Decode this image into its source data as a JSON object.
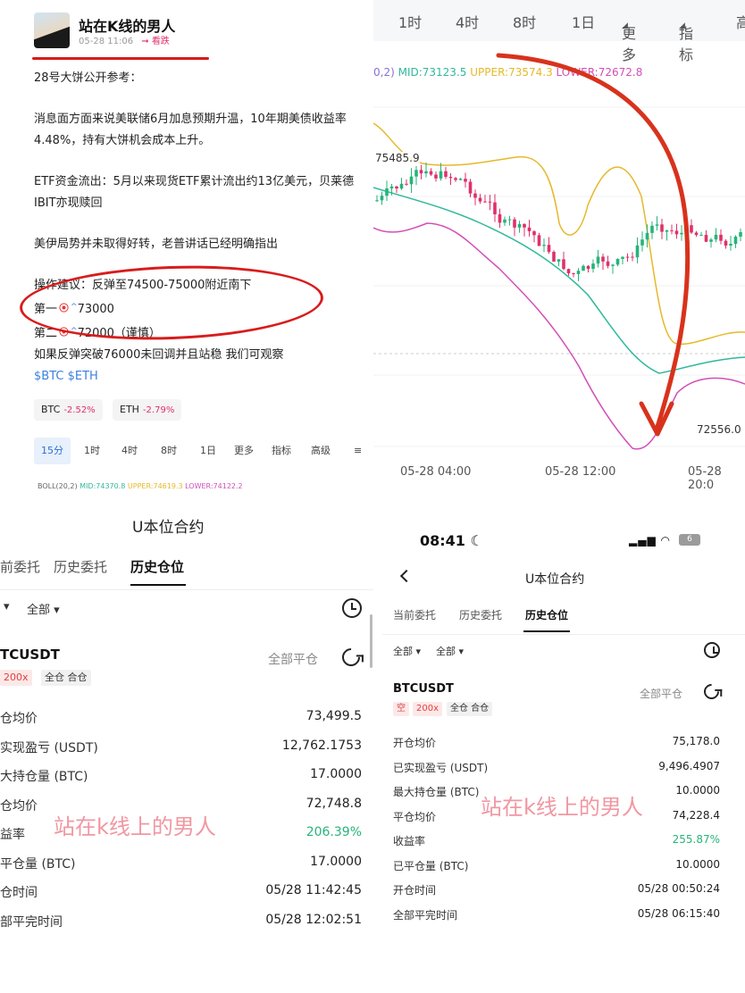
{
  "post": {
    "author": "站在K线的男人",
    "time": "05-28 11:06",
    "tag": "看跌",
    "lines": [
      "28号大饼公开参考：",
      "消息面方面来说美联储6月加息预期升温，10年期美债收益率4.48%，持有大饼机会成本上升。",
      "ETF资金流出：5月以来现货ETF累计流出约13亿美元，贝莱德IBIT亦现赎回",
      "美伊局势并未取得好转，老普讲话已经明确指出",
      "操作建议：反弹至74500-75000附近南下",
      "第一",
      "73000",
      "第二",
      "72000（谨慎）",
      "如果反弹突破76000未回调并且站稳 我们可观察"
    ],
    "hashtags": "$BTC $ETH",
    "coins": [
      {
        "name": "BTC",
        "change": "-2.52%"
      },
      {
        "name": "ETH",
        "change": "-2.79%"
      }
    ],
    "timeframes": [
      "15分",
      "1时",
      "4时",
      "8时",
      "1日",
      "更多",
      "指标",
      "高级"
    ],
    "boll": {
      "prefix": "BOLL(20,2)",
      "mid": "MID:74370.8",
      "upper": "UPPER:74619.3",
      "lower": "LOWER:74122.2"
    }
  },
  "chart": {
    "tabs": [
      "1时",
      "4时",
      "8时",
      "1日",
      "更多",
      "指标",
      "高"
    ],
    "boll": {
      "prefix": "0,2)",
      "mid": "MID:73123.5",
      "upper": "UPPER:73574.3",
      "lower": "LOWER:72672.8"
    },
    "high_label": "75485.9",
    "low_label": "72556.0",
    "time_labels": [
      "05-28 04:00",
      "05-28 12:00",
      "05-28 20:0"
    ],
    "colors": {
      "up": "#26b47a",
      "down": "#e0306b",
      "upper": "#e5b92a",
      "mid": "#2fb99a",
      "lower": "#d24fb8",
      "arrow": "#d8321c"
    }
  },
  "left_history": {
    "title": "U本位合约",
    "tabs": [
      "前委托",
      "历史委托",
      "历史仓位"
    ],
    "filters": [
      "全部"
    ],
    "symbol": "TCUSDT",
    "close_all": "全部平仓",
    "leverage": "200x",
    "mode": "全仓 合仓",
    "rows": [
      {
        "label": "仓均价",
        "value": "73,499.5"
      },
      {
        "label": "实现盈亏 (USDT)",
        "value": "12,762.1753"
      },
      {
        "label": "大持仓量 (BTC)",
        "value": "17.0000"
      },
      {
        "label": "仓均价",
        "value": "72,748.8"
      },
      {
        "label": "益率",
        "value": "206.39%"
      },
      {
        "label": "平仓量 (BTC)",
        "value": "17.0000"
      },
      {
        "label": "仓时间",
        "value": "05/28 11:42:45"
      },
      {
        "label": "部平完时间",
        "value": "05/28 12:02:51"
      }
    ],
    "watermark": "站在k线上的男人"
  },
  "right_history": {
    "status_time": "08:41",
    "battery": "6",
    "title": "U本位合约",
    "tabs": [
      "当前委托",
      "历史委托",
      "历史仓位"
    ],
    "filters": [
      "全部",
      "全部"
    ],
    "symbol": "BTCUSDT",
    "close_all": "全部平仓",
    "side": "空",
    "leverage": "200x",
    "mode": "全仓 合仓",
    "rows": [
      {
        "label": "开仓均价",
        "value": "75,178.0"
      },
      {
        "label": "已实现盈亏 (USDT)",
        "value": "9,496.4907"
      },
      {
        "label": "最大持仓量 (BTC)",
        "value": "10.0000"
      },
      {
        "label": "平仓均价",
        "value": "74,228.4"
      },
      {
        "label": "收益率",
        "value": "255.87%"
      },
      {
        "label": "已平仓量 (BTC)",
        "value": "10.0000"
      },
      {
        "label": "开仓时间",
        "value": "05/28 00:50:24"
      },
      {
        "label": "全部平完时间",
        "value": "05/28 06:15:40"
      }
    ],
    "watermark": "站在k线上的男人"
  }
}
